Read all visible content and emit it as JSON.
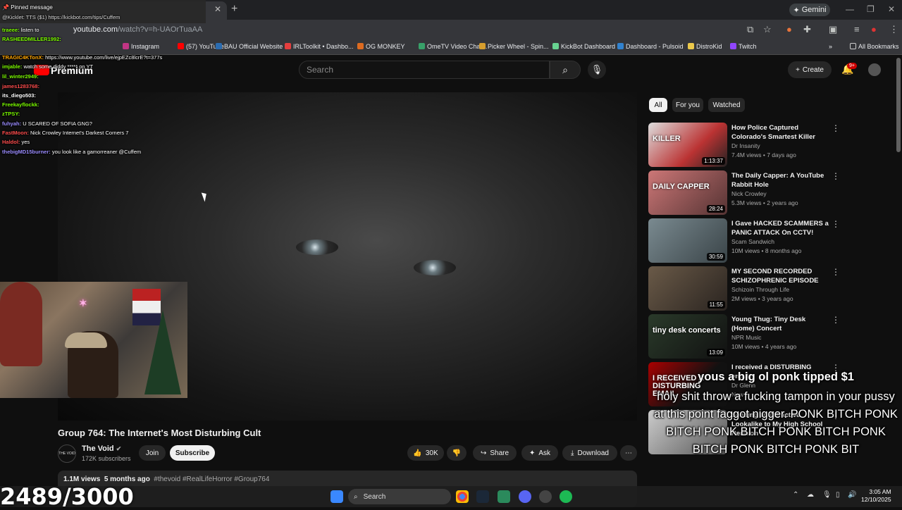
{
  "browser": {
    "url_host": "youtube.com",
    "url_path": "/watch?v=h-UAOrTuaAA",
    "gemini_label": "Gemini",
    "all_bookmarks": "All Bookmarks",
    "bookmarks": [
      "(57) YouTube",
      "BAU Official Website",
      "IRLToolkit • Dashbo...",
      "OG MONKEY",
      "OmeTV Video Chat...",
      "Picker Wheel - Spin...",
      "KickBot Dashboard",
      "Dashboard - Pulsoid",
      "DistroKid",
      "Twitch"
    ],
    "bookmark_colors": [
      "#ff0000",
      "#2b6cb0",
      "#e53e3e",
      "#dd6b20",
      "#38a169",
      "#d69e2e",
      "#68d391",
      "#3182ce",
      "#ecc94b",
      "#9146ff"
    ],
    "bookmark_partial": [
      "Instagram"
    ]
  },
  "youtube": {
    "logo_text": "Premium",
    "search_placeholder": "Search",
    "create_label": "Create",
    "notif_badge": "9+",
    "filters": [
      "All",
      "For you",
      "Watched"
    ],
    "video": {
      "title": "Group 764: The Internet's Most Disturbing Cult",
      "channel": "The Void",
      "channel_avatar_text": "THE VOID",
      "subscribers": "172K subscribers",
      "join_label": "Join",
      "subscribe_label": "Subscribe",
      "likes": "30K",
      "share_label": "Share",
      "ask_label": "Ask",
      "download_label": "Download",
      "views": "1.1M views",
      "age": "5 months ago",
      "tags": "#thevoid #RealLifeHorror #Group764"
    },
    "recommendations": [
      {
        "title": "How Police Captured Colorado's Smartest Killer",
        "channel": "Dr Insanity",
        "meta": "7.4M views • 7 days ago",
        "duration": "1:13:37",
        "thumb_text": "KILLER"
      },
      {
        "title": "The Daily Capper: A YouTube Rabbit Hole",
        "channel": "Nick Crowley",
        "meta": "5.3M views • 2 years ago",
        "duration": "28:24",
        "thumb_text": "DAILY CAPPER"
      },
      {
        "title": "I Gave HACKED SCAMMERS a PANIC ATTACK On CCTV!",
        "channel": "Scam Sandwich",
        "meta": "10M views • 8 months ago",
        "duration": "30:59",
        "thumb_text": ""
      },
      {
        "title": "MY SECOND RECORDED SCHIZOPHRENIC EPISODE",
        "channel": "Schizoin Through Life",
        "meta": "2M views • 3 years ago",
        "duration": "11:55",
        "thumb_text": ""
      },
      {
        "title": "Young Thug: Tiny Desk (Home) Concert",
        "channel": "NPR Music",
        "meta": "10M views • 4 years ago",
        "duration": "13:09",
        "thumb_text": "tiny desk concerts"
      },
      {
        "title": "I received a DISTURBING email.",
        "channel": "Dr Glenn",
        "meta": "New",
        "duration": "",
        "thumb_text": "I RECEIVED A DISTURBING EMAIL"
      },
      {
        "title": "Sending an Attractive Lookalike to My High School Reunion",
        "channel": "",
        "meta": "",
        "duration": "",
        "thumb_text": ""
      }
    ]
  },
  "overlay": {
    "pinned_header": "Pinned message",
    "pinned_text": "@Kicklet: TTS ($1) https://kickbot.com/tips/Cuffem",
    "chat": [
      {
        "user": "traeee:",
        "msg": "listen to",
        "color": "#7cfc00"
      },
      {
        "user": "RASHEEDMILLER1992:",
        "msg": "",
        "color": "#7cfc00"
      },
      {
        "user": "TRAGIC4KTonX:",
        "msg": "https://www.youtube.com/live/ejpEZc8lcrE?t=377s",
        "color": "#ffa500"
      },
      {
        "user": "imjable:",
        "msg": "watch some diddy ***** on YT",
        "color": "#7cfc00"
      },
      {
        "user": "lil_winter2949:",
        "msg": "",
        "color": "#7cfc00"
      },
      {
        "user": "james1283768:",
        "msg": "",
        "color": "#ff4d4d"
      },
      {
        "user": "its_diego503:",
        "msg": "",
        "color": "#ffffff"
      },
      {
        "user": "Freekayflockk:",
        "msg": "",
        "color": "#7cfc00"
      },
      {
        "user": "zTPSY:",
        "msg": "",
        "color": "#7cfc00"
      },
      {
        "user": "fuhyah:",
        "msg": "U SCARED OF SOFIA GNG?",
        "color": "#9b8cff"
      },
      {
        "user": "FastMoon:",
        "msg": "Nick Crowley Internet's Darkest Corners 7",
        "color": "#ff4d4d"
      },
      {
        "user": "Haldol:",
        "msg": "yes",
        "color": "#ff4d4d"
      },
      {
        "user": "thebigMD15burner:",
        "msg": "you look like a gamorreaner @Cuffem",
        "color": "#9b8cff"
      }
    ],
    "tts_title": "yous a big ol ponk tipped $1",
    "tts_message": "holy shit throw a fucking tampon in your pussy at this point faggot nigger. PONK BITCH PONK BITCH PONK BITCH PONK BITCH PONK BITCH PONK BITCH PONK BIT",
    "counter": "2489/3000"
  },
  "taskbar": {
    "search_label": "Search",
    "time": "3:05 AM",
    "date": "12/10/2025"
  }
}
